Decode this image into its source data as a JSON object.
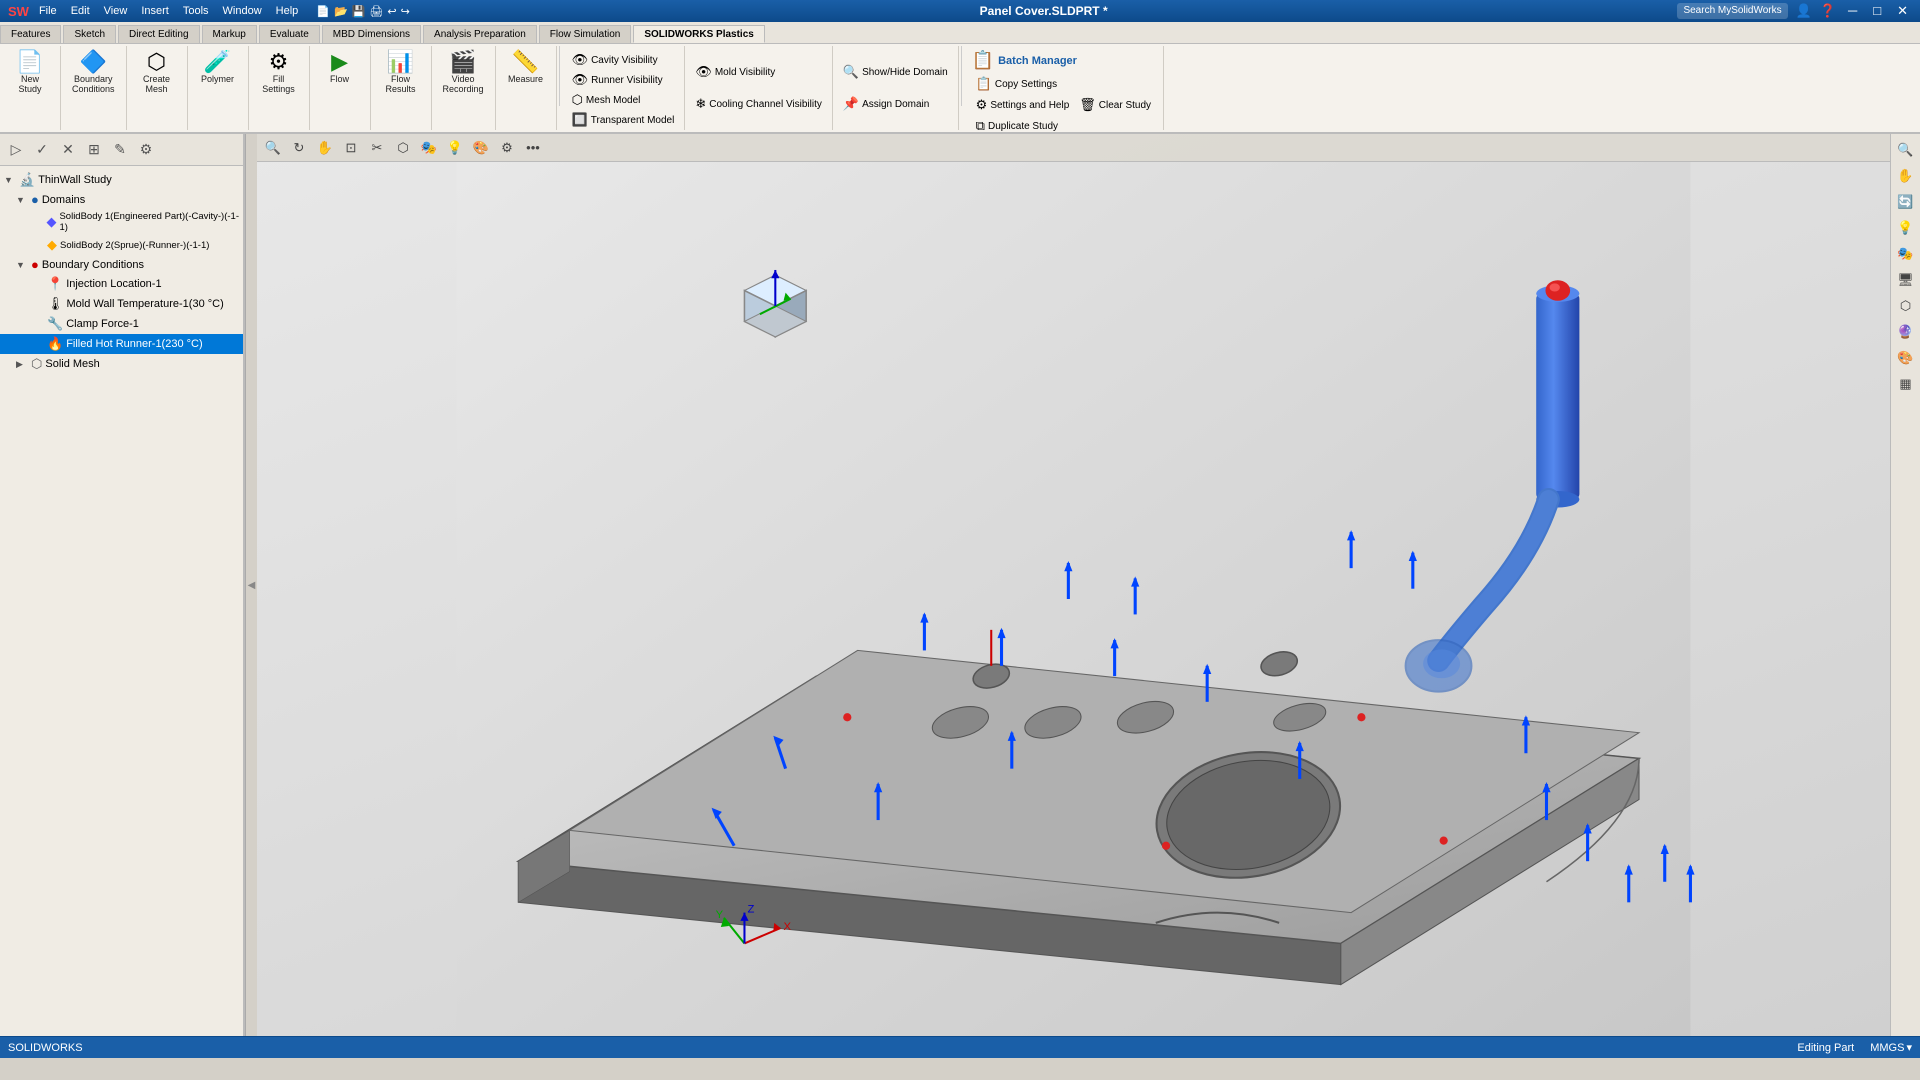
{
  "titlebar": {
    "logo": "SW",
    "title": "Panel Cover.SLDPRT *",
    "search_placeholder": "Search MySolidWorks",
    "window_controls": [
      "─",
      "□",
      "✕"
    ]
  },
  "menubar": {
    "items": [
      "File",
      "Edit",
      "View",
      "Insert",
      "Tools",
      "Window",
      "Help"
    ]
  },
  "toolbar_tabs": {
    "items": [
      "Features",
      "Sketch",
      "Direct Editing",
      "Markup",
      "Evaluate",
      "MBD Dimensions",
      "Analysis Preparation",
      "Flow Simulation",
      "SOLIDWORKS Plastics"
    ],
    "active": "SOLIDWORKS Plastics"
  },
  "ribbon": {
    "groups": [
      {
        "id": "new-study",
        "label": "",
        "buttons": [
          {
            "id": "new-study-btn",
            "icon": "📄",
            "label": "New\nStudy"
          }
        ]
      },
      {
        "id": "boundary-conditions",
        "label": "Boundary Conditions",
        "buttons": [
          {
            "id": "boundary-conditions-btn",
            "icon": "🔷",
            "label": "Boundary\nConditions"
          }
        ]
      },
      {
        "id": "create-mesh",
        "label": "",
        "buttons": [
          {
            "id": "create-mesh-btn",
            "icon": "⬡",
            "label": "Create\nMesh"
          }
        ]
      },
      {
        "id": "polymer",
        "label": "",
        "buttons": [
          {
            "id": "polymer-btn",
            "icon": "🧪",
            "label": "Polymer"
          }
        ]
      },
      {
        "id": "fill-settings",
        "label": "",
        "buttons": [
          {
            "id": "fill-settings-btn",
            "icon": "⚙",
            "label": "Fill\nSettings"
          }
        ]
      },
      {
        "id": "flow",
        "label": "",
        "buttons": [
          {
            "id": "flow-btn",
            "icon": "▶",
            "label": "Flow"
          }
        ]
      },
      {
        "id": "flow-results",
        "label": "",
        "buttons": [
          {
            "id": "flow-results-btn",
            "icon": "📊",
            "label": "Flow\nResults"
          }
        ]
      },
      {
        "id": "video-recording",
        "label": "",
        "buttons": [
          {
            "id": "video-btn",
            "icon": "🎬",
            "label": "Video\nRecording"
          }
        ]
      },
      {
        "id": "measure",
        "label": "",
        "buttons": [
          {
            "id": "measure-btn",
            "icon": "📏",
            "label": "Measure"
          }
        ]
      }
    ],
    "right_groups": [
      {
        "id": "visibility",
        "items": [
          {
            "id": "cavity-visibility",
            "label": "Cavity Visibility",
            "icon": "👁"
          },
          {
            "id": "runner-visibility",
            "label": "Runner Visibility",
            "icon": "👁"
          },
          {
            "id": "mesh-model",
            "label": "Mesh Model",
            "icon": "⬡"
          },
          {
            "id": "transparent-model",
            "label": "Transparent Model",
            "icon": "🔲"
          }
        ]
      },
      {
        "id": "domain-group",
        "items": [
          {
            "id": "show-hide-domain",
            "label": "Show/Hide Domain",
            "icon": "🔍"
          },
          {
            "id": "assign-domain",
            "label": "Assign Domain",
            "icon": "📌"
          }
        ]
      },
      {
        "id": "mold-group",
        "items": [
          {
            "id": "mold-visibility",
            "label": "Mold Visibility",
            "icon": "👁"
          },
          {
            "id": "cooling-channel",
            "label": "Cooling Channel Visibility",
            "icon": "❄"
          }
        ]
      }
    ],
    "batch": {
      "label": "Batch Manager",
      "icon": "📋",
      "items": [
        {
          "id": "copy-settings",
          "label": "Copy Settings",
          "icon": "📋"
        },
        {
          "id": "settings-help",
          "label": "Settings and Help",
          "icon": "⚙"
        },
        {
          "id": "clear-study",
          "label": "Clear Study",
          "icon": "🗑"
        },
        {
          "id": "duplicate-study",
          "label": "Duplicate Study",
          "icon": "⧉"
        }
      ]
    }
  },
  "panel": {
    "toolbar_buttons": [
      "▷",
      "▷▷",
      "✕",
      "⊞",
      "✎",
      "⚙"
    ],
    "tree": {
      "root": "ThinWall Study",
      "nodes": [
        {
          "id": "domains",
          "label": "Domains",
          "icon": "🔵",
          "level": 1,
          "expanded": true
        },
        {
          "id": "solidbody1",
          "label": "SolidBody 1(Engineered Part)(-Cavity-)(-1-1)",
          "icon": "🔷",
          "level": 2
        },
        {
          "id": "solidbody2",
          "label": "SolidBody 2(Sprue)(-Runner-)(-1-1)",
          "icon": "🔶",
          "level": 2
        },
        {
          "id": "boundary-conditions",
          "label": "Boundary Conditions",
          "icon": "🔴",
          "level": 1,
          "expanded": true
        },
        {
          "id": "injection-location",
          "label": "Injection Location-1",
          "icon": "📍",
          "level": 2
        },
        {
          "id": "mold-wall-temp",
          "label": "Mold Wall Temperature-1(30 °C)",
          "icon": "🌡",
          "level": 2
        },
        {
          "id": "clamp-force",
          "label": "Clamp Force-1",
          "icon": "🔧",
          "level": 2
        },
        {
          "id": "filled-hot-runner",
          "label": "Filled Hot Runner-1(230 °C)",
          "icon": "🔥",
          "level": 2,
          "selected": true
        },
        {
          "id": "solid-mesh",
          "label": "Solid Mesh",
          "icon": "⬡",
          "level": 1
        }
      ]
    }
  },
  "viewport": {
    "top_toolbar": [
      "🔍+",
      "🔍-",
      "🔍◎",
      "📐",
      "↕",
      "↔",
      "🔄",
      "🏠",
      "👁",
      "💡",
      "🎨",
      "⚙",
      "•••"
    ],
    "right_toolbar": [
      "📐",
      "📷",
      "🔄",
      "💡",
      "🎭",
      "🖥",
      "⬡",
      "🔮",
      "🎨",
      "▦",
      "•••"
    ]
  },
  "statusbar": {
    "left": "SOLIDWORKS",
    "center": "",
    "right_editing": "Editing Part",
    "right_units": "MMGS",
    "arrow": "▾"
  }
}
